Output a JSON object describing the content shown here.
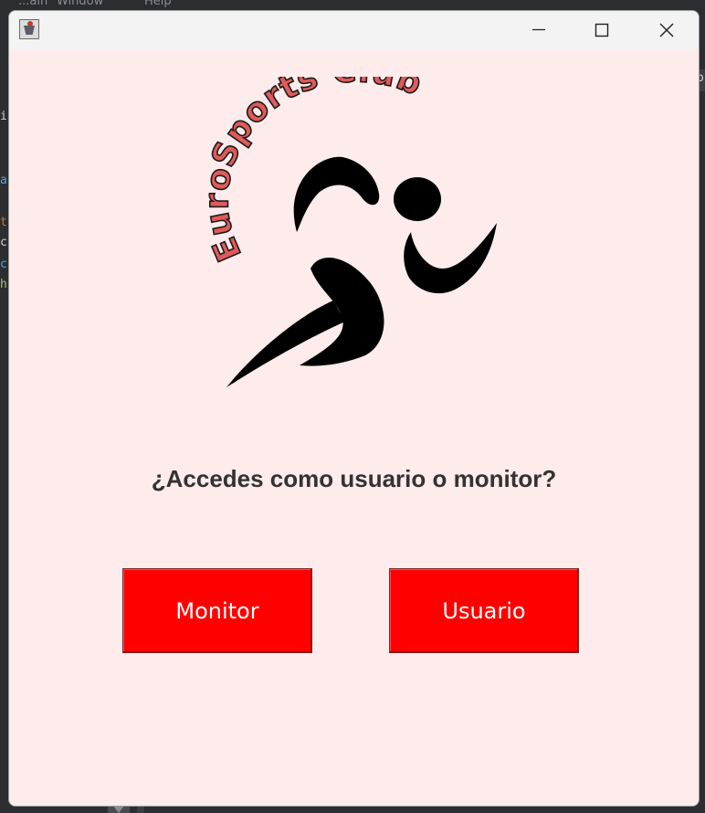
{
  "background_ide": {
    "menu_items": [
      "...ain",
      "Window",
      "Help"
    ],
    "code_fragments": [
      {
        "text": "i",
        "color": "#cfd2d6"
      },
      {
        "text": "a",
        "color": "#5aa0d8"
      },
      {
        "text": "t",
        "color": "#cc7832"
      },
      {
        "text": "c",
        "color": "#cfd2d6"
      },
      {
        "text": "c",
        "color": "#5aa0d8"
      },
      {
        "text": "h",
        "color": "#a5c261"
      }
    ],
    "right_fragment": "o"
  },
  "window": {
    "app_icon": "java-cup-icon",
    "controls": {
      "minimize": "minimize-icon",
      "maximize": "maximize-icon",
      "close": "close-icon"
    }
  },
  "logo": {
    "text": "EuroSports Club",
    "text_color": "#e05a5a",
    "figure_color": "#000000"
  },
  "main": {
    "question": "¿Accedes como usuario o monitor?",
    "buttons": {
      "monitor": "Monitor",
      "usuario": "Usuario"
    },
    "accent": "#ff0000",
    "background": "#feebeb"
  }
}
